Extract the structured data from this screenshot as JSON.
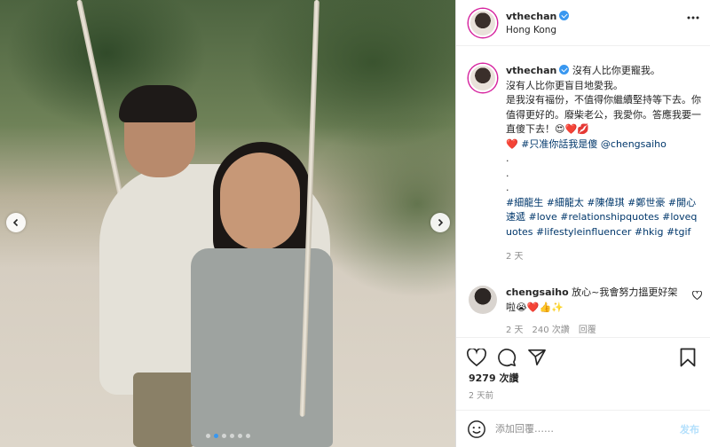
{
  "photo": {
    "alt": "couple on a rope swing",
    "pager_count": 6,
    "pager_active_index": 1,
    "prev_icon": "chevron-left-icon",
    "next_icon": "chevron-right-icon"
  },
  "post": {
    "author": "vthechan",
    "location": "Hong Kong",
    "caption": {
      "line1": "沒有人比你更寵我。",
      "line2": "沒有人比你更盲目地愛我。",
      "line3": "是我沒有福份，不值得你繼續堅持等下去。你值得更好的。廢柴老公，我愛你。答應我要一直傻下去！😍❤️💋",
      "line4": "❤️",
      "line4_tags": " #只准你話我是傻 @chengsaiho",
      "dots": [
        ".",
        ".",
        "."
      ],
      "hashtags": "#細龍生 #細龍太 #陳偉琪 #鄭世豪 #開心速遞 #love #relationshipquotes #lovequotes #lifestyleinfluencer #hkig #tgif",
      "time": "2 天"
    },
    "comment": {
      "author": "chengsaiho",
      "text": "放心~我會努力搵更好架啦😭❤️👍✨",
      "time": "2 天",
      "likes": "240 次讚",
      "reply": "回覆"
    },
    "likes": "9279 次讚",
    "posted": "2 天前"
  },
  "input": {
    "placeholder": "添加回覆……",
    "post_label": "发布"
  },
  "colors": {
    "link": "#00376b",
    "verified": "#3897f0",
    "muted": "#8e8e8e",
    "post_button": "#b2dffc"
  }
}
